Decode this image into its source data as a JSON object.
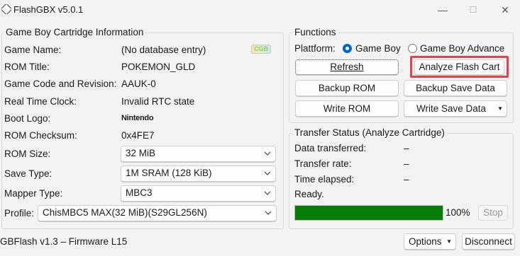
{
  "window": {
    "title": "FlashGBX v5.0.1",
    "minimize": "—",
    "maximize": "☐",
    "close": "✕"
  },
  "cart_info": {
    "title": "Game Boy Cartridge Information",
    "rows": [
      {
        "label": "Game Name:",
        "value": "(No database entry)"
      },
      {
        "label": "ROM Title:",
        "value": "POKEMON_GLD"
      },
      {
        "label": "Game Code and Revision:",
        "value": "AAUK-0"
      },
      {
        "label": "Real Time Clock:",
        "value": "Invalid RTC state"
      },
      {
        "label": "Boot Logo:",
        "value": "Nintendo"
      },
      {
        "label": "ROM Checksum:",
        "value": "0x4FE7"
      }
    ],
    "cgb_badge": "CGB",
    "rom_size": {
      "label": "ROM Size:",
      "value": "32 MiB"
    },
    "save_type": {
      "label": "Save Type:",
      "value": "1M SRAM (128 KiB)"
    },
    "mapper_type": {
      "label": "Mapper Type:",
      "value": "MBC3"
    }
  },
  "profile": {
    "label": "Profile:",
    "value": "ChisMBC5 MAX(32 MiB)(S29GL256N)"
  },
  "functions": {
    "title": "Functions",
    "platform_label": "Plattform:",
    "platform_options": [
      "Game Boy",
      "Game Boy Advance"
    ],
    "selected_platform": "Game Boy",
    "buttons": {
      "refresh": "Refresh",
      "analyze": "Analyze Flash Cart",
      "backup_rom": "Backup ROM",
      "backup_save": "Backup Save Data",
      "write_rom": "Write ROM",
      "write_save": "Write Save Data"
    }
  },
  "transfer": {
    "title": "Transfer Status (Analyze Cartridge)",
    "rows": [
      {
        "label": "Data transferred:",
        "value": "–"
      },
      {
        "label": "Transfer rate:",
        "value": "–"
      },
      {
        "label": "Time elapsed:",
        "value": "–"
      }
    ],
    "status": "Ready.",
    "progress_percent": 100,
    "progress_label": "100%",
    "stop_label": "Stop"
  },
  "footer": {
    "device": "GBFlash v1.3 – Firmware L15",
    "options_label": "Options",
    "disconnect_label": "Disconnect"
  },
  "colors": {
    "progress": "#067d06",
    "highlight": "#e0424e",
    "accent": "#0067c0"
  },
  "icons": [
    "app-icon",
    "chevron-down-icon",
    "minimize-icon",
    "maximize-icon",
    "close-icon"
  ]
}
